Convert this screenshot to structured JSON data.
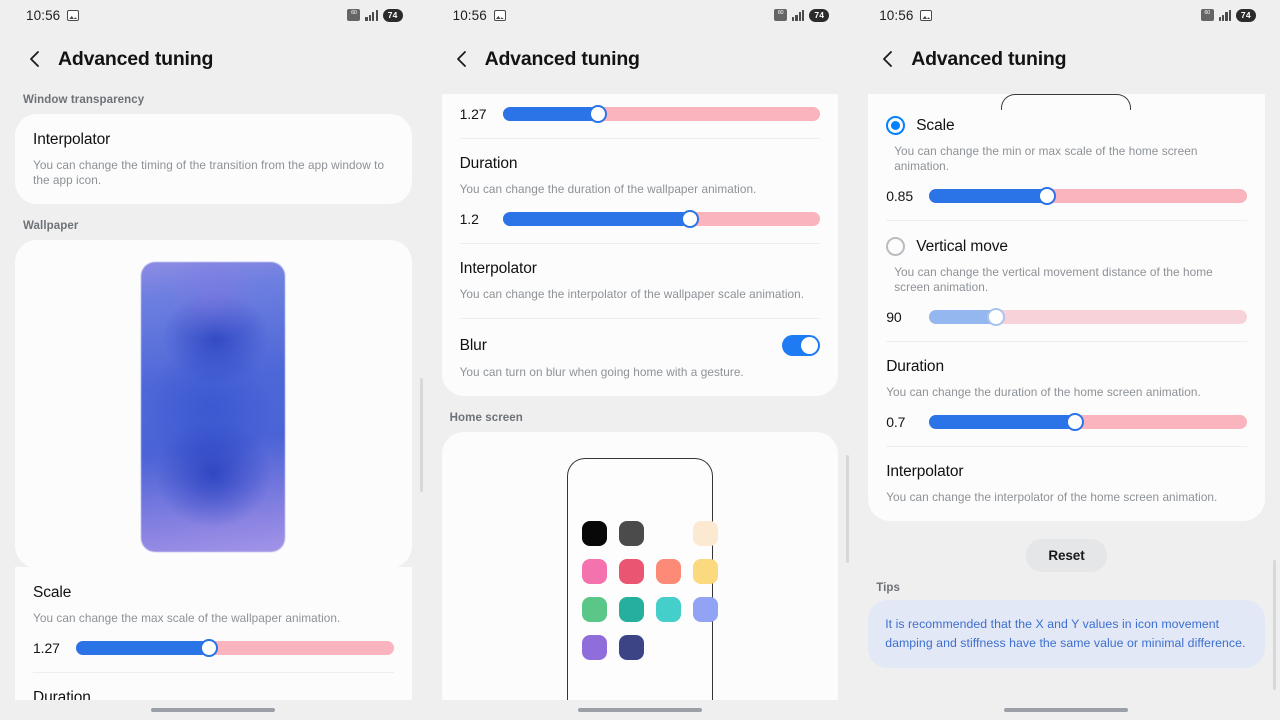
{
  "status_bar": {
    "time": "10:56",
    "photo_icon": "photo-icon",
    "sim_icon": "sim-card-icon",
    "signal_icon": "signal-bars-icon",
    "battery_level": "74"
  },
  "app_bar": {
    "back_icon": "back-chevron-icon",
    "title": "Advanced tuning"
  },
  "panel1": {
    "section_window_transparency": "Window transparency",
    "interpolator": {
      "title": "Interpolator",
      "desc": "You can change the timing of the transition from the app window to the app icon."
    },
    "section_wallpaper": "Wallpaper",
    "wallpaper_preview_name": "wallpaper-preview",
    "scale": {
      "title": "Scale",
      "desc": "You can change the max scale of the wallpaper animation.",
      "value": "1.27",
      "fill_percent": 42
    },
    "duration_title": "Duration"
  },
  "panel2": {
    "top_slider": {
      "value": "1.27",
      "fill_percent": 30
    },
    "duration": {
      "title": "Duration",
      "desc": "You can change the duration of the wallpaper animation.",
      "value": "1.2",
      "fill_percent": 59
    },
    "interpolator": {
      "title": "Interpolator",
      "desc": "You can change the interpolator of the wallpaper scale animation."
    },
    "blur": {
      "title": "Blur",
      "desc": "You can turn on blur when going home with a gesture.",
      "toggle_state": "on"
    },
    "section_home_screen": "Home screen",
    "home_preview_name": "home-screen-preview",
    "app_icon_colors": [
      "#080808",
      "#4b4b4b",
      "",
      "#fce9d2",
      "#f472ae",
      "#ea5671",
      "#fb8a76",
      "#fbd97f",
      "#5ac789",
      "#24af9e",
      "#44cfcb",
      "#92a2f4",
      "#8f6edb",
      "#3c4486",
      "",
      ""
    ]
  },
  "panel3": {
    "scale": {
      "title": "Scale",
      "radio_state": "selected",
      "desc": "You can change the min or max scale of the home screen animation.",
      "value": "0.85",
      "fill_percent": 37
    },
    "vertical_move": {
      "title": "Vertical move",
      "radio_state": "unselected",
      "desc": "You can change the vertical movement distance of the home screen animation.",
      "value": "90",
      "fill_percent": 21
    },
    "duration": {
      "title": "Duration",
      "desc": "You can change the duration of the home screen animation.",
      "value": "0.7",
      "fill_percent": 46
    },
    "interpolator": {
      "title": "Interpolator",
      "desc": "You can change the interpolator of the home screen animation."
    },
    "reset_label": "Reset",
    "tips_label": "Tips",
    "tips_text": "It is recommended that the X and Y values in icon movement damping and stiffness have the same value or minimal difference."
  },
  "colors": {
    "accent_blue": "#2b74e8",
    "track_pink": "#f9b4bd",
    "radio_blue": "#0381fe",
    "toggle_on": "#1e7bf4",
    "tips_bg": "#e2e8f5",
    "tips_text": "#3d6fd0"
  }
}
